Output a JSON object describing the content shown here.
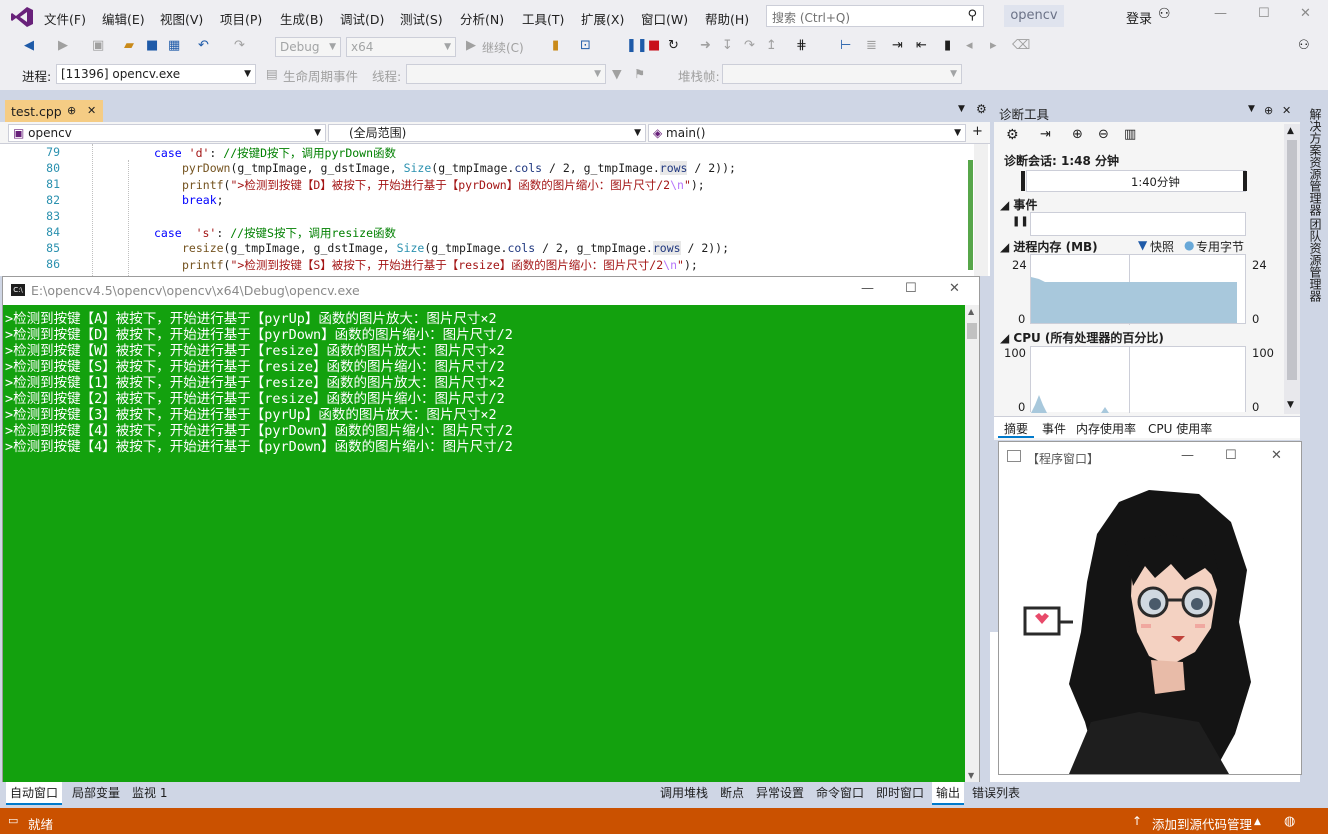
{
  "menubar": {
    "items": [
      "文件(F)",
      "编辑(E)",
      "视图(V)",
      "项目(P)",
      "生成(B)",
      "调试(D)",
      "测试(S)",
      "分析(N)",
      "工具(T)",
      "扩展(X)",
      "窗口(W)",
      "帮助(H)"
    ],
    "search_placeholder": "搜索 (Ctrl+Q)",
    "solution_name": "opencv",
    "login_label": "登录"
  },
  "toolbar": {
    "config": "Debug",
    "platform": "x64",
    "continue_label": "继续(C)"
  },
  "toolbar2": {
    "process_label": "进程:",
    "process_value": "[11396] opencv.exe",
    "lifecycle_label": "生命周期事件",
    "thread_label": "线程:",
    "stackframe_label": "堆栈帧:"
  },
  "editor": {
    "tab_name": "test.cpp",
    "tab_pin": "⊕",
    "tab_close": "✕",
    "nav_project": "opencv",
    "nav_scope": "(全局范围)",
    "nav_function": "main()",
    "lines": [
      {
        "num": "79"
      },
      {
        "num": "80"
      },
      {
        "num": "81"
      },
      {
        "num": "82"
      },
      {
        "num": "83"
      },
      {
        "num": "84"
      },
      {
        "num": "85"
      },
      {
        "num": "86"
      }
    ]
  },
  "console": {
    "title": "E:\\opencv4.5\\opencv\\opencv\\x64\\Debug\\opencv.exe",
    "lines": [
      ">检测到按键【A】被按下，开始进行基于【pyrUp】函数的图片放大：图片尺寸×2",
      ">检测到按键【D】被按下，开始进行基于【pyrDown】函数的图片缩小：图片尺寸/2",
      ">检测到按键【W】被按下，开始进行基于【resize】函数的图片放大：图片尺寸×2",
      ">检测到按键【S】被按下，开始进行基于【resize】函数的图片缩小：图片尺寸/2",
      ">检测到按键【1】被按下，开始进行基于【resize】函数的图片放大：图片尺寸×2",
      ">检测到按键【2】被按下，开始进行基于【resize】函数的图片缩小：图片尺寸/2",
      ">检测到按键【3】被按下，开始进行基于【pyrUp】函数的图片放大：图片尺寸×2",
      ">检测到按键【4】被按下，开始进行基于【pyrDown】函数的图片缩小：图片尺寸/2",
      ">检测到按键【4】被按下，开始进行基于【pyrDown】函数的图片缩小：图片尺寸/2"
    ]
  },
  "diagnostics": {
    "title": "诊断工具",
    "session": "诊断会话: 1:48 分钟",
    "timeline_label": "1:40分钟",
    "events_label": "事件",
    "memory_label": "进程内存 (MB)",
    "snapshot_label": "快照",
    "private_label": "专用字节",
    "mem_max": "24",
    "mem_min": "0",
    "cpu_label": "CPU (所有处理器的百分比)",
    "cpu_max": "100",
    "cpu_min": "0",
    "tabs": [
      "摘要",
      "事件",
      "内存使用率",
      "CPU 使用率"
    ]
  },
  "right_rail": {
    "items": [
      "解决方案资源管理器",
      "团队资源管理器"
    ]
  },
  "program_window": {
    "title": "【程序窗口】"
  },
  "bottom_tabs": {
    "left": [
      "自动窗口",
      "局部变量",
      "监视 1"
    ],
    "right": [
      "调用堆栈",
      "断点",
      "异常设置",
      "命令窗口",
      "即时窗口",
      "输出",
      "错误列表"
    ]
  },
  "status": {
    "ready": "就绪",
    "source_control": "添加到源代码管理"
  }
}
